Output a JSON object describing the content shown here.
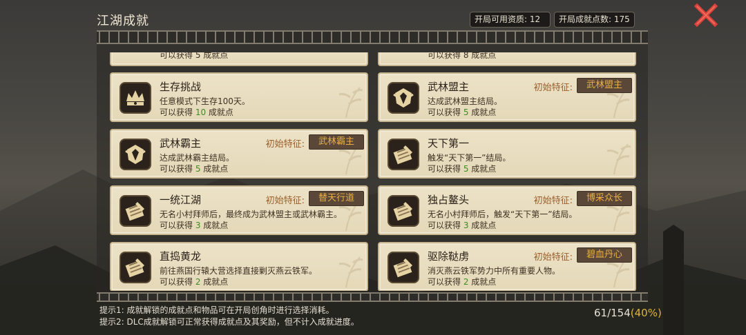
{
  "header": {
    "title": "江湖成就",
    "available_resources_label": "开局可用资质:",
    "available_resources_value": "12",
    "achievement_points_label": "开局成就点数:",
    "achievement_points_value": "175"
  },
  "partial_cards": {
    "left_text": "可以获得 5 成就点",
    "right_text": "可以获得 8 成就点"
  },
  "cards": [
    {
      "name": "生存挑战",
      "desc": "任意模式下生存100天。",
      "pts_prefix": "可以获得 ",
      "pts": "10",
      "pts_suffix": " 成就点",
      "trait_label": "",
      "trait": ""
    },
    {
      "name": "武林盟主",
      "desc": "达成武林盟主结局。",
      "pts_prefix": "可以获得 ",
      "pts": "5",
      "pts_suffix": " 成就点",
      "trait_label": "初始特征:",
      "trait": "武林盟主"
    },
    {
      "name": "武林霸主",
      "desc": "达成武林霸主结局。",
      "pts_prefix": "可以获得 ",
      "pts": "5",
      "pts_suffix": " 成就点",
      "trait_label": "初始特征:",
      "trait": "武林霸主"
    },
    {
      "name": "天下第一",
      "desc": "触发“天下第一”结局。",
      "pts_prefix": "可以获得 ",
      "pts": "5",
      "pts_suffix": " 成就点",
      "trait_label": "",
      "trait": ""
    },
    {
      "name": "一统江湖",
      "desc": "无名小村拜师后，最终成为武林盟主或武林霸主。",
      "pts_prefix": "可以获得 ",
      "pts": "3",
      "pts_suffix": " 成就点",
      "trait_label": "初始特征:",
      "trait": "替天行道"
    },
    {
      "name": "独占鳌头",
      "desc": "无名小村拜师后，触发“天下第一”结局。",
      "pts_prefix": "可以获得 ",
      "pts": "3",
      "pts_suffix": " 成就点",
      "trait_label": "初始特征:",
      "trait": "博采众长"
    },
    {
      "name": "直捣黄龙",
      "desc": "前往燕国行辕大营选择直接剿灭燕云铁军。",
      "pts_prefix": "可以获得 ",
      "pts": "2",
      "pts_suffix": " 成就点",
      "trait_label": "",
      "trait": ""
    },
    {
      "name": "驱除鞑虏",
      "desc": "消灭燕云铁军势力中所有重要人物。",
      "pts_prefix": "可以获得 ",
      "pts": "2",
      "pts_suffix": " 成就点",
      "trait_label": "初始特征:",
      "trait": "碧血丹心"
    }
  ],
  "icons": [
    "crown-icon",
    "crest-icon",
    "crest-icon",
    "scroll-icon",
    "scroll-icon",
    "scroll-icon",
    "scroll-icon",
    "scroll-icon"
  ],
  "footer": {
    "tip1": "提示1: 成就解锁的成就点和物品可在开局创角时进行选择消耗。",
    "tip2": "提示2: DLC成就解锁可正常获得成就点及其奖励，但不计入成就进度。",
    "progress_count": "61/154",
    "progress_pct": "(40%)"
  },
  "colors": {
    "accent_green": "#3f8a22",
    "trait_gold": "#e9b045",
    "close_red": "#d8423c"
  }
}
